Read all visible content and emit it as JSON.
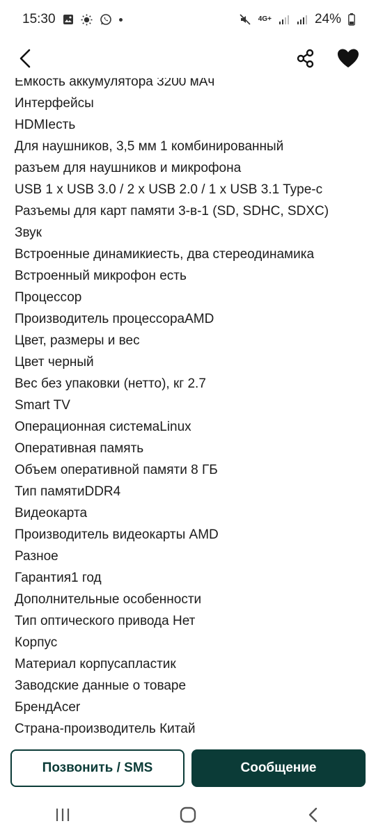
{
  "status": {
    "time": "15:30",
    "network": "4G+",
    "battery": "24%"
  },
  "icons": {
    "back": "chevron-left-icon",
    "share": "share-icon",
    "favorite": "heart-icon"
  },
  "specs": [
    "Ёмкость аккумулятора 3200 мАч",
    "Интерфейсы",
    "HDMIесть",
    "Для наушников, 3,5 мм  1 комбинированный",
    "разъем для наушников и микрофона",
    "USB 1 x USB 3.0 / 2 x USB 2.0 / 1 x USB 3.1 Type-c",
    "Разъемы для карт памяти  3-в-1 (SD, SDHC, SDXC)",
    "Звук",
    "Встроенные динамикиесть, два стереодинамика",
    "Встроенный микрофон  есть",
    "Процессор",
    "Производитель процессораAMD",
    "Цвет, размеры и вес",
    "Цвет черный",
    "Вес без упаковки (нетто), кг 2.7",
    "Smart TV",
    "Операционная системаLinux",
    "Оперативная память",
    "Объем оперативной памяти  8 ГБ",
    "Тип памятиDDR4",
    "Видеокарта",
    "Производитель видеокарты AMD",
    "Разное",
    "Гарантия1 год",
    "Дополнительные особенности",
    "Тип оптического привода Нет",
    "Корпус",
    "Материал корпусапластик",
    "Заводские данные о товаре",
    "БрендAcer",
    "Страна-производитель  Китай"
  ],
  "actions": {
    "call_label": "Позвонить / SMS",
    "message_label": "Сообщение"
  },
  "colors": {
    "accent": "#0b3b37",
    "text": "#1c1c1c"
  }
}
